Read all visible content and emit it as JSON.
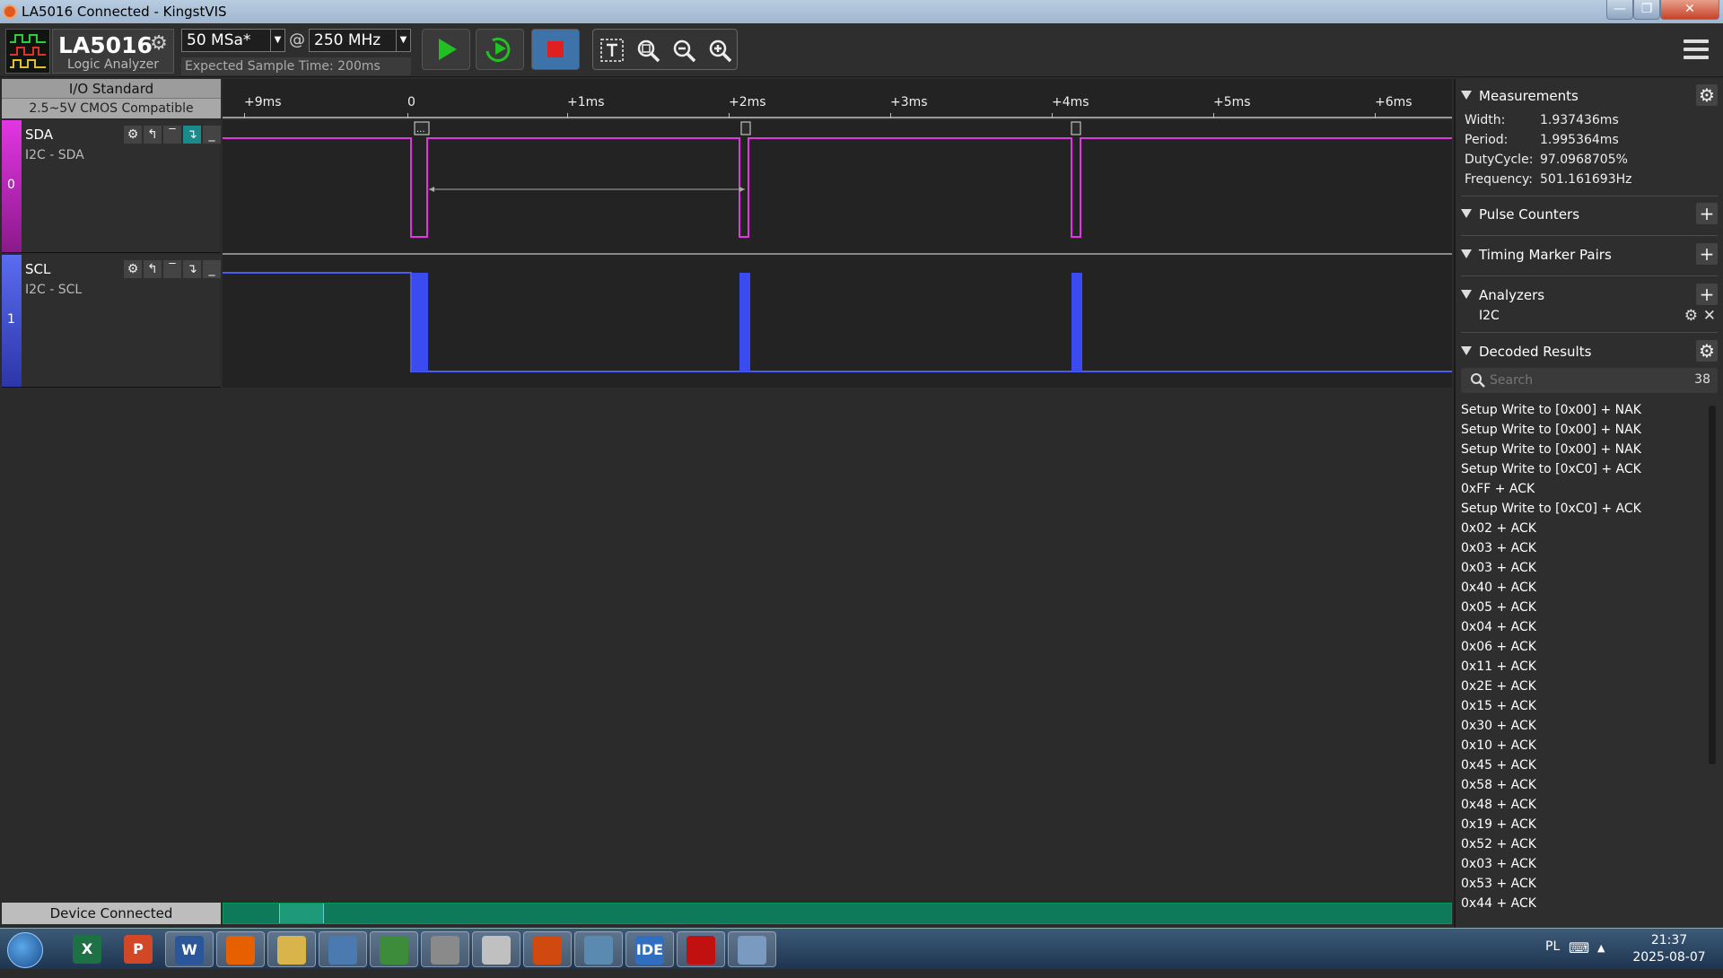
{
  "window": {
    "title": "LA5016 Connected - KingstVIS"
  },
  "toolbar": {
    "device_model": "LA5016",
    "device_subtitle": "Logic Analyzer",
    "sample_rate": "50 MSa*",
    "at_symbol": "@",
    "sample_depth": "250 MHz",
    "expected_time": "Expected Sample Time: 200ms"
  },
  "io_standard": {
    "title": "I/O Standard",
    "value": "2.5~5V CMOS Compatible"
  },
  "channels": [
    {
      "index": "0",
      "name": "SDA",
      "description": "I2C - SDA",
      "color": "#e236e2"
    },
    {
      "index": "1",
      "name": "SCL",
      "description": "I2C - SCL",
      "color": "#4a5cf0"
    }
  ],
  "timeline": {
    "ticks": [
      "+9ms",
      "0",
      "+1ms",
      "+2ms",
      "+3ms",
      "+4ms",
      "+5ms",
      "+6ms"
    ],
    "marker_label": "..."
  },
  "status": {
    "text": "Device Connected"
  },
  "panel": {
    "measurements": {
      "title": "Measurements",
      "rows": [
        {
          "label": "Width:",
          "value": "1.937436ms"
        },
        {
          "label": "Period:",
          "value": "1.995364ms"
        },
        {
          "label": "DutyCycle:",
          "value": "97.0968705%"
        },
        {
          "label": "Frequency:",
          "value": "501.161693Hz"
        }
      ]
    },
    "pulse_counters": {
      "title": "Pulse Counters"
    },
    "timing_marker_pairs": {
      "title": "Timing Marker Pairs"
    },
    "analyzers": {
      "title": "Analyzers",
      "items": [
        "I2C"
      ]
    },
    "decoded": {
      "title": "Decoded Results",
      "search_placeholder": "Search",
      "count": "38",
      "results": [
        "Setup Write to [0x00] + NAK",
        "Setup Write to [0x00] + NAK",
        "Setup Write to [0x00] + NAK",
        "Setup Write to [0xC0] + ACK",
        "0xFF + ACK",
        "Setup Write to [0xC0] + ACK",
        "0x02 + ACK",
        "0x03 + ACK",
        "0x03 + ACK",
        "0x40 + ACK",
        "0x05 + ACK",
        "0x04 + ACK",
        "0x06 + ACK",
        "0x11 + ACK",
        "0x2E + ACK",
        "0x15 + ACK",
        "0x30 + ACK",
        "0x10 + ACK",
        "0x45 + ACK",
        "0x58 + ACK",
        "0x48 + ACK",
        "0x19 + ACK",
        "0x52 + ACK",
        "0x03 + ACK",
        "0x53 + ACK",
        "0x44 + ACK"
      ]
    }
  },
  "taskbar": {
    "apps": [
      "X",
      "P",
      "W",
      "",
      "",
      "",
      "",
      "",
      "",
      "",
      "",
      "IDE",
      "",
      ""
    ],
    "language": "PL",
    "time": "21:37",
    "date": "2025-08-07"
  }
}
